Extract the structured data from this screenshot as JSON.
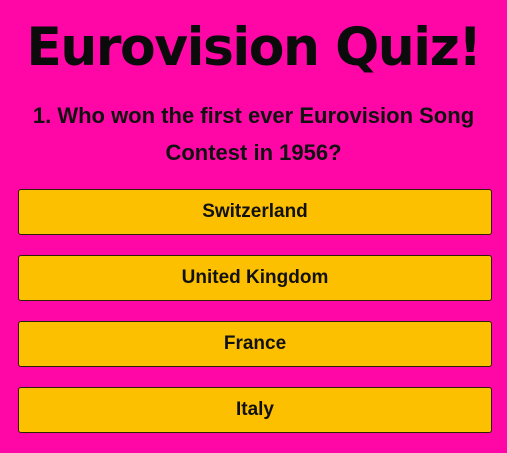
{
  "title": "Eurovision Quiz!",
  "question": "1. Who won the first ever Eurovision Song Contest in 1956?",
  "answers": [
    "Switzerland",
    "United Kingdom",
    "France",
    "Italy"
  ],
  "colors": {
    "background": "#ff07a6",
    "answer_button": "#fcc000",
    "text": "#111111"
  }
}
